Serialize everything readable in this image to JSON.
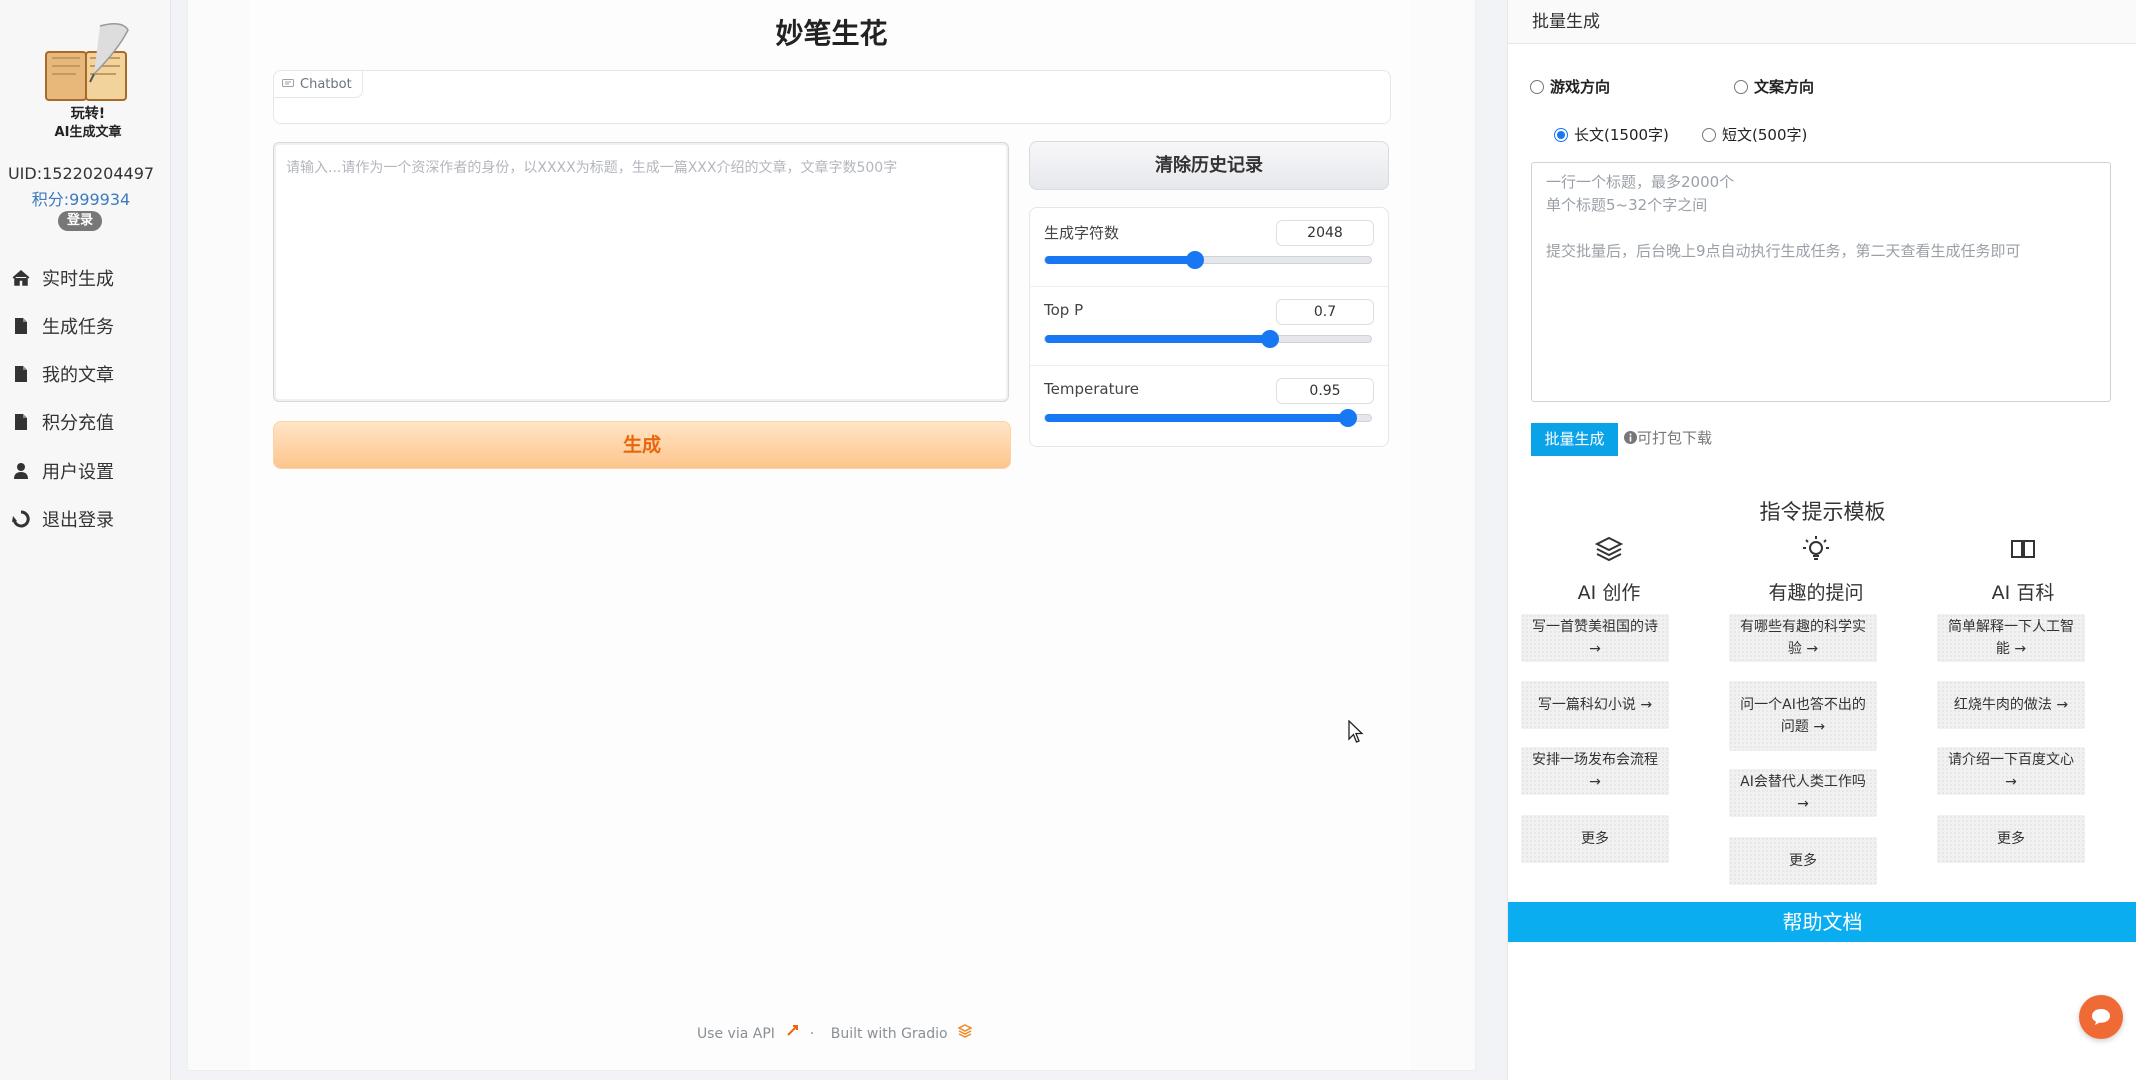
{
  "sidebar": {
    "logo_text": "玩转! AI生成文章",
    "uid": "UID:15220204497",
    "points": "积分:999934",
    "login_label": "登录",
    "items": [
      {
        "label": "实时生成",
        "icon": "home-icon"
      },
      {
        "label": "生成任务",
        "icon": "file-icon"
      },
      {
        "label": "我的文章",
        "icon": "file-icon"
      },
      {
        "label": "积分充值",
        "icon": "file-icon"
      },
      {
        "label": "用户设置",
        "icon": "user-icon"
      },
      {
        "label": "退出登录",
        "icon": "recycle-icon"
      }
    ]
  },
  "main": {
    "title": "妙笔生花",
    "chatbot_label": "Chatbot",
    "prompt_placeholder": "请输入...请作为一个资深作者的身份，以XXXX为标题，生成一篇XXX介绍的文章，文章字数500字",
    "generate_label": "生成",
    "clear_label": "清除历史记录",
    "params": [
      {
        "label": "生成字符数",
        "value": "2048",
        "fraction": 0.46
      },
      {
        "label": "Top P",
        "value": "0.7",
        "fraction": 0.69
      },
      {
        "label": "Temperature",
        "value": "0.95",
        "fraction": 0.93
      }
    ],
    "footer": {
      "api": "Use via API",
      "sep": "·",
      "built": "Built with Gradio"
    }
  },
  "batch": {
    "header": "批量生成",
    "direction_options": [
      "游戏方向",
      "文案方向"
    ],
    "length_options": [
      "长文(1500字)",
      "短文(500字)"
    ],
    "length_selected": 0,
    "titles_placeholder": "一行一个标题，最多2000个\n单个标题5~32个字之间\n\n提交批量后，后台晚上9点自动执行生成任务，第二天查看生成任务即可",
    "batch_button": "批量生成",
    "pack_note": "可打包下载",
    "templates_title": "指令提示模板",
    "columns": [
      {
        "title": "AI 创作",
        "icon": "layers-icon",
        "items": [
          "写一首赞美祖国的诗 →",
          "写一篇科幻小说 →",
          "安排一场发布会流程 →",
          "更多"
        ]
      },
      {
        "title": "有趣的提问",
        "icon": "lightbulb-icon",
        "items": [
          "有哪些有趣的科学实验 →",
          "问一个AI也答不出的问题 →",
          "AI会替代人类工作吗 →",
          "更多"
        ]
      },
      {
        "title": "AI 百科",
        "icon": "book-icon",
        "items": [
          "简单解释一下人工智能 →",
          "红烧牛肉的做法 →",
          "请介绍一下百度文心 →",
          "更多"
        ]
      }
    ],
    "help_button": "帮助文档"
  },
  "colors": {
    "accent": "#1877f2",
    "orange": "#e8660e",
    "batch_blue": "#0aa3e8",
    "help_blue": "#0aaef0",
    "fab": "#f06a35"
  }
}
